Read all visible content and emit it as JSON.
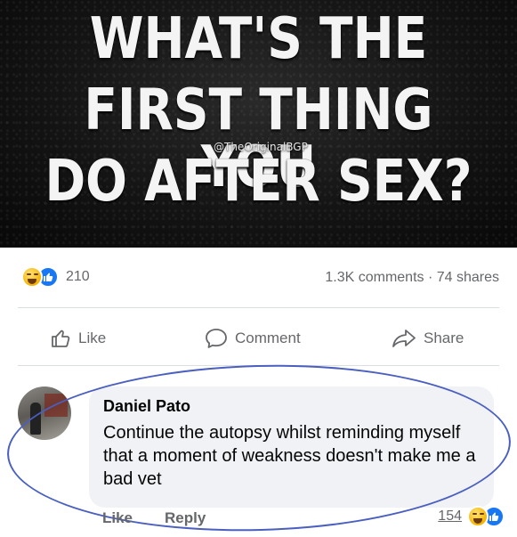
{
  "banner": {
    "line1": "WHAT'S THE",
    "line2": "FIRST THING YOU",
    "line3": "DO AFTER SEX?",
    "watermark": "@TheOriginalBGP"
  },
  "post_stats": {
    "reaction_count": "210",
    "comments_shares": "1.3K comments · 74 shares"
  },
  "actions": {
    "like": "Like",
    "comment": "Comment",
    "share": "Share"
  },
  "comment": {
    "author": "Daniel Pato",
    "text": "Continue the autopsy whilst reminding myself that a moment of weakness doesn't make me a bad vet",
    "like_label": "Like",
    "reply_label": "Reply",
    "reaction_count": "154"
  },
  "colors": {
    "accent": "#1877f2",
    "muted": "#65676b",
    "bubble": "#f0f2f5",
    "circle_annotation": "#4a5fc0"
  },
  "icons": [
    "haha-emoji-icon",
    "like-reaction-icon",
    "thumbs-up-icon",
    "comment-icon",
    "share-icon"
  ]
}
